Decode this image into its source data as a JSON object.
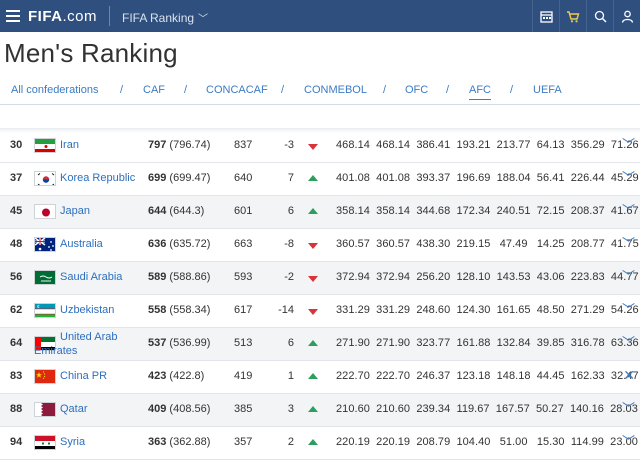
{
  "header": {
    "logo_main": "FIFA",
    "logo_suffix": ".com",
    "section": "FIFA Ranking",
    "icons": [
      "menu-icon",
      "calendar-icon",
      "cart-icon",
      "search-icon",
      "user-icon"
    ]
  },
  "page": {
    "title": "Men's Ranking"
  },
  "tabs": [
    {
      "label": "All confederations",
      "active": false
    },
    {
      "label": "CAF",
      "active": false
    },
    {
      "label": "CONCACAF",
      "active": false
    },
    {
      "label": "CONMEBOL",
      "active": false
    },
    {
      "label": "OFC",
      "active": false
    },
    {
      "label": "AFC",
      "active": true
    },
    {
      "label": "UEFA",
      "active": false
    }
  ],
  "tab_separator": "/",
  "rows": [
    {
      "rank": "30",
      "team": "Iran",
      "points": "797",
      "points_detail": "(796.74)",
      "previous": "837",
      "movement": "-3",
      "trend": "down",
      "figures": "468.14  468.14  386.41  193.21  213.77  64.13  356.29  71.26",
      "flag": "iran"
    },
    {
      "rank": "37",
      "team": "Korea Republic",
      "points": "699",
      "points_detail": "(699.47)",
      "previous": "640",
      "movement": "7",
      "trend": "up",
      "figures": "401.08  401.08  393.37  196.69  188.04  56.41  226.44  45.29",
      "flag": "korea"
    },
    {
      "rank": "45",
      "team": "Japan",
      "points": "644",
      "points_detail": "(644.3)",
      "previous": "601",
      "movement": "6",
      "trend": "up",
      "figures": "358.14  358.14  344.68  172.34  240.51  72.15  208.37  41.67",
      "flag": "japan"
    },
    {
      "rank": "48",
      "team": "Australia",
      "points": "636",
      "points_detail": "(635.72)",
      "previous": "663",
      "movement": "-8",
      "trend": "down",
      "figures": "360.57  360.57  438.30  219.15   47.49   14.25  208.77  41.75",
      "flag": "australia"
    },
    {
      "rank": "56",
      "team": "Saudi Arabia",
      "points": "589",
      "points_detail": "(588.86)",
      "previous": "593",
      "movement": "-2",
      "trend": "down",
      "figures": "372.94  372.94  256.20  128.10  143.53  43.06  223.83  44.77",
      "flag": "saudi"
    },
    {
      "rank": "62",
      "team": "Uzbekistan",
      "points": "558",
      "points_detail": "(558.34)",
      "previous": "617",
      "movement": "-14",
      "trend": "down",
      "figures": "331.29  331.29  248.60  124.30  161.65  48.50  271.29  54.26",
      "flag": "uzbekistan"
    },
    {
      "rank": "64",
      "team_line1": "United Arab",
      "team_line2": "Emirates",
      "points": "537",
      "points_detail": "(536.99)",
      "previous": "513",
      "movement": "6",
      "trend": "up",
      "figures": "271.90  271.90  323.77  161.88  132.84  39.85  316.78  63.36",
      "flag": "uae"
    },
    {
      "rank": "83",
      "team": "China PR",
      "points": "423",
      "points_detail": "(422.8)",
      "previous": "419",
      "movement": "1",
      "trend": "up",
      "figures": "222.70  222.70  246.37  123.18  148.18  44.45  162.33  32.47",
      "flag": "china"
    },
    {
      "rank": "88",
      "team": "Qatar",
      "points": "409",
      "points_detail": "(408.56)",
      "previous": "385",
      "movement": "3",
      "trend": "up",
      "figures": "210.60  210.60  239.34  119.67  167.57  50.27  140.16  28.03",
      "flag": "qatar"
    },
    {
      "rank": "94",
      "team": "Syria",
      "points": "363",
      "points_detail": "(362.88)",
      "previous": "357",
      "movement": "2",
      "trend": "up",
      "figures": "220.19  220.19  208.79  104.40   51.00   15.30  114.99  23.00",
      "flag": "syria"
    }
  ],
  "colors": {
    "header_bg": "#2f4f7e",
    "link": "#3b7cc4",
    "up": "#2c9f5f",
    "down": "#d8343a"
  }
}
